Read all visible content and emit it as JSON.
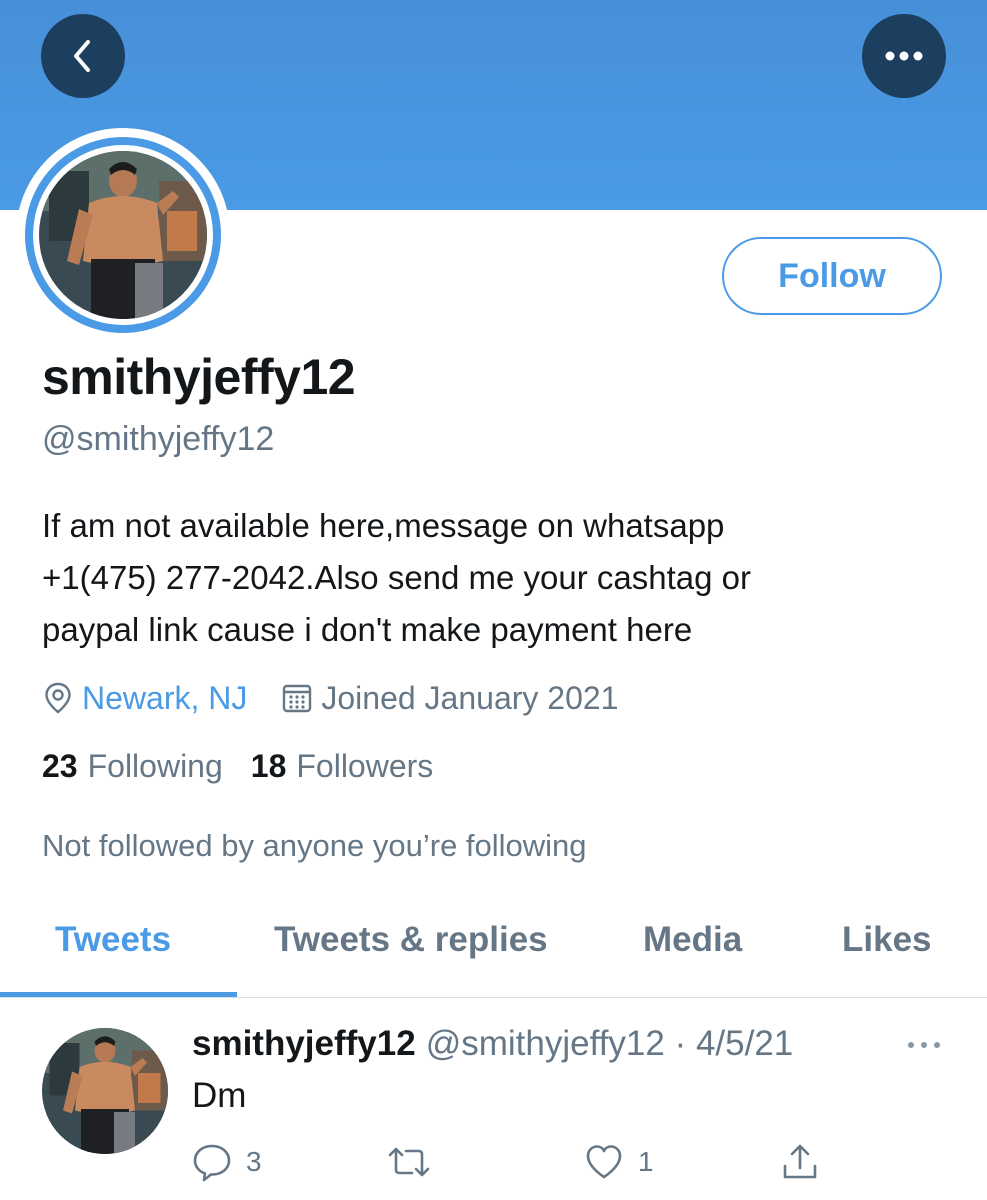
{
  "header": {
    "back_icon": "chevron-left-icon",
    "more_icon": "more-horizontal-icon"
  },
  "profile": {
    "follow_label": "Follow",
    "display_name": "smithyjeffy12",
    "handle": "@smithyjeffy12",
    "bio_lines": [
      "If am not available here,message on whatsapp",
      "+1(475) 277-2042.Also send me your cashtag or",
      "paypal link cause i don't make payment here"
    ],
    "location": "Newark, NJ",
    "joined": "Joined January 2021",
    "following_count": "23",
    "following_label": "Following",
    "followers_count": "18",
    "followers_label": "Followers",
    "not_followed_text": "Not followed by anyone you’re following"
  },
  "tabs": [
    {
      "label": "Tweets",
      "active": true
    },
    {
      "label": "Tweets & replies",
      "active": false
    },
    {
      "label": "Media",
      "active": false
    },
    {
      "label": "Likes",
      "active": false
    }
  ],
  "tweet": {
    "name": "smithyjeffy12",
    "handle_date": "@smithyjeffy12 · 4/5/21",
    "text": "Dm",
    "reply_count": "3",
    "like_count": "1"
  },
  "colors": {
    "accent": "#4a9ae6",
    "banner": "#4790d8",
    "round_button": "#1d3f5f",
    "text_primary": "#14171a",
    "text_secondary": "#657786"
  }
}
